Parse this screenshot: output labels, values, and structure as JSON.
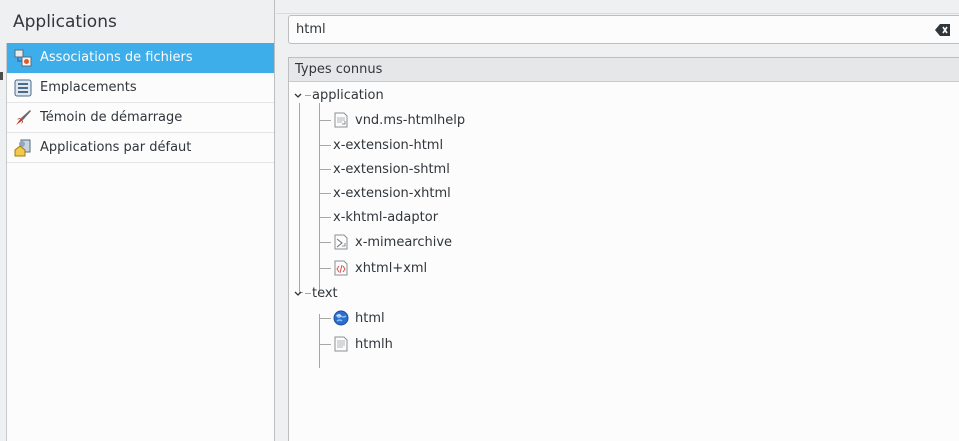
{
  "sidebar": {
    "title": "Applications",
    "items": [
      {
        "label": "Associations de fichiers",
        "icon": "file-associations-icon"
      },
      {
        "label": "Emplacements",
        "icon": "locations-icon"
      },
      {
        "label": "Témoin de démarrage",
        "icon": "launch-feedback-icon"
      },
      {
        "label": "Applications par défaut",
        "icon": "default-applications-icon"
      }
    ]
  },
  "search": {
    "value": "html"
  },
  "tree": {
    "header": "Types connus",
    "groups": [
      {
        "label": "application",
        "children": [
          "vnd.ms-htmlhelp",
          "x-extension-html",
          "x-extension-shtml",
          "x-extension-xhtml",
          "x-khtml-adaptor",
          "x-mimearchive",
          "xhtml+xml"
        ]
      },
      {
        "label": "text",
        "children": [
          "html",
          "htmlh"
        ]
      }
    ]
  },
  "colors": {
    "selection": "#3daee9",
    "background": "#eff0f1"
  }
}
